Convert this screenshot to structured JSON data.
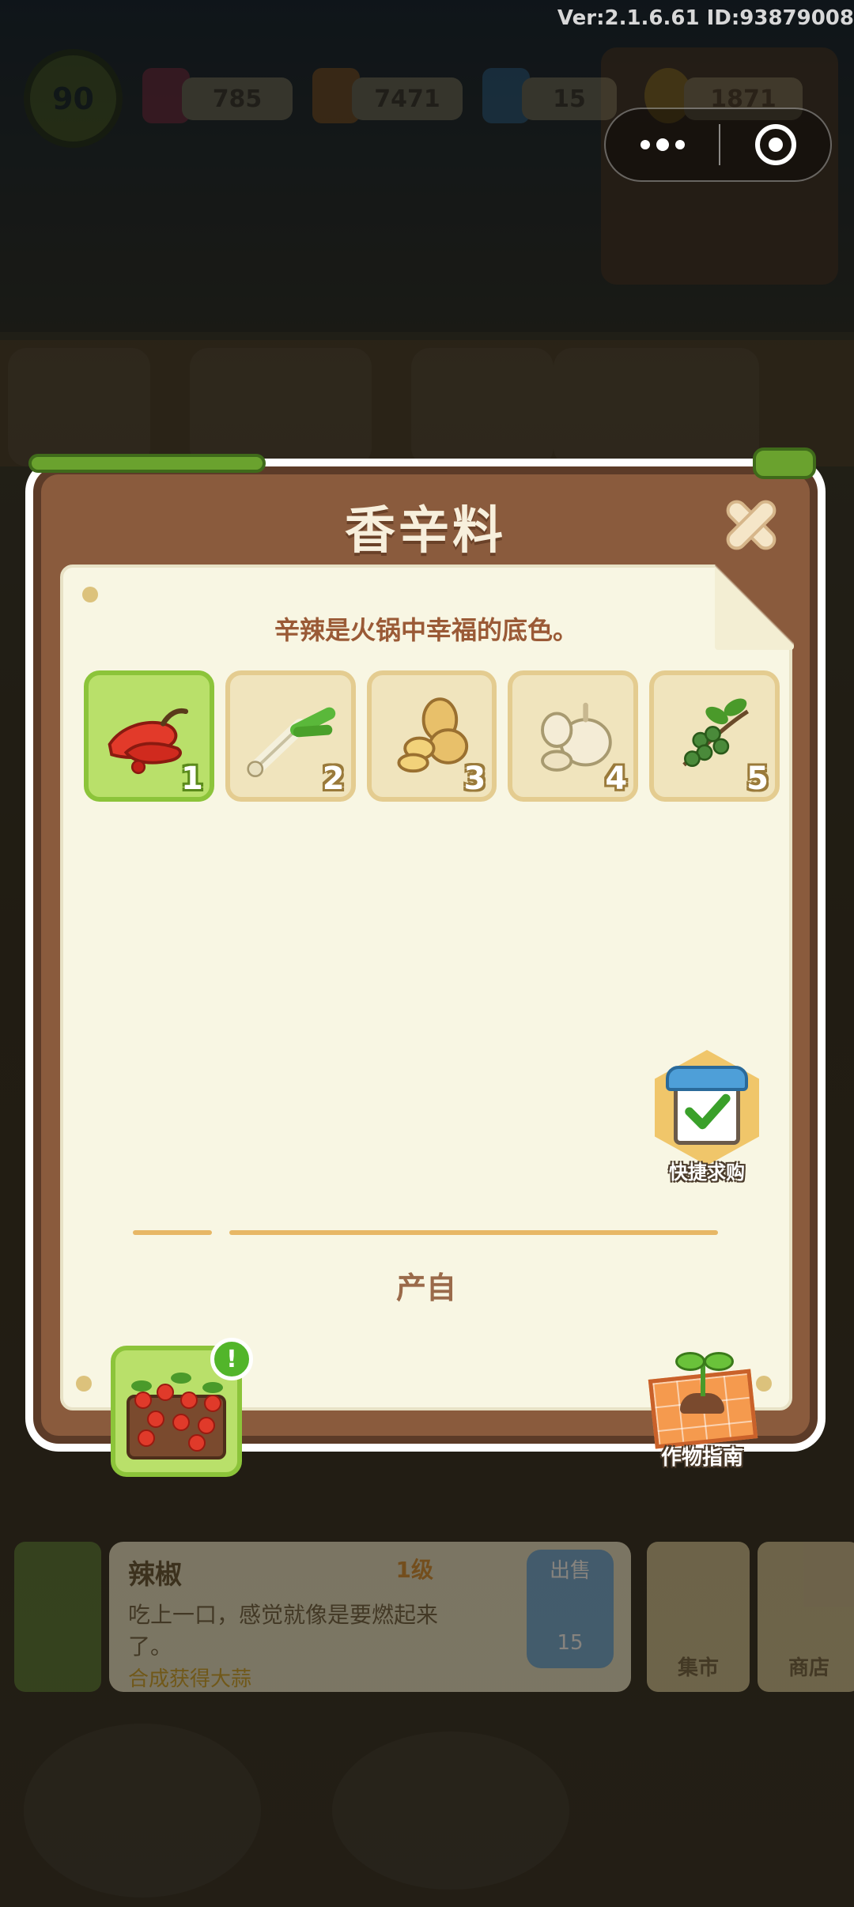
{
  "system": {
    "version_text": "Ver:2.1.6.61 ID:93879008"
  },
  "hud": {
    "level": "90",
    "gems": "785",
    "carrots": "7471",
    "energy": "15",
    "coins": "1871"
  },
  "modal": {
    "title": "香辛料",
    "description": "辛辣是火锅中幸福的底色。",
    "items": [
      {
        "name": "chili-pepper",
        "number": "1",
        "selected": true
      },
      {
        "name": "scallion",
        "number": "2",
        "selected": false
      },
      {
        "name": "ginger",
        "number": "3",
        "selected": false
      },
      {
        "name": "garlic",
        "number": "4",
        "selected": false
      },
      {
        "name": "sichuan-pepper",
        "number": "5",
        "selected": false
      }
    ],
    "quick_buy_label": "快捷求购",
    "source_heading": "产自",
    "source_alert": "!",
    "crop_guide_label": "作物指南"
  },
  "bottom_bar": {
    "item_name": "辣椒",
    "item_level": "1级",
    "item_desc": "吃上一口，感觉就像是要燃起来了。",
    "item_hint": "合成获得大蒜",
    "sell_label": "出售",
    "sell_price": "15",
    "market_label": "集市",
    "shop_label": "商店"
  },
  "colors": {
    "panel_brown": "#8a5b3d",
    "paper": "#f8f6e3",
    "selected_green": "#b9e06a",
    "tile_tan": "#f0e4bd",
    "accent_orange": "#e7b766"
  }
}
